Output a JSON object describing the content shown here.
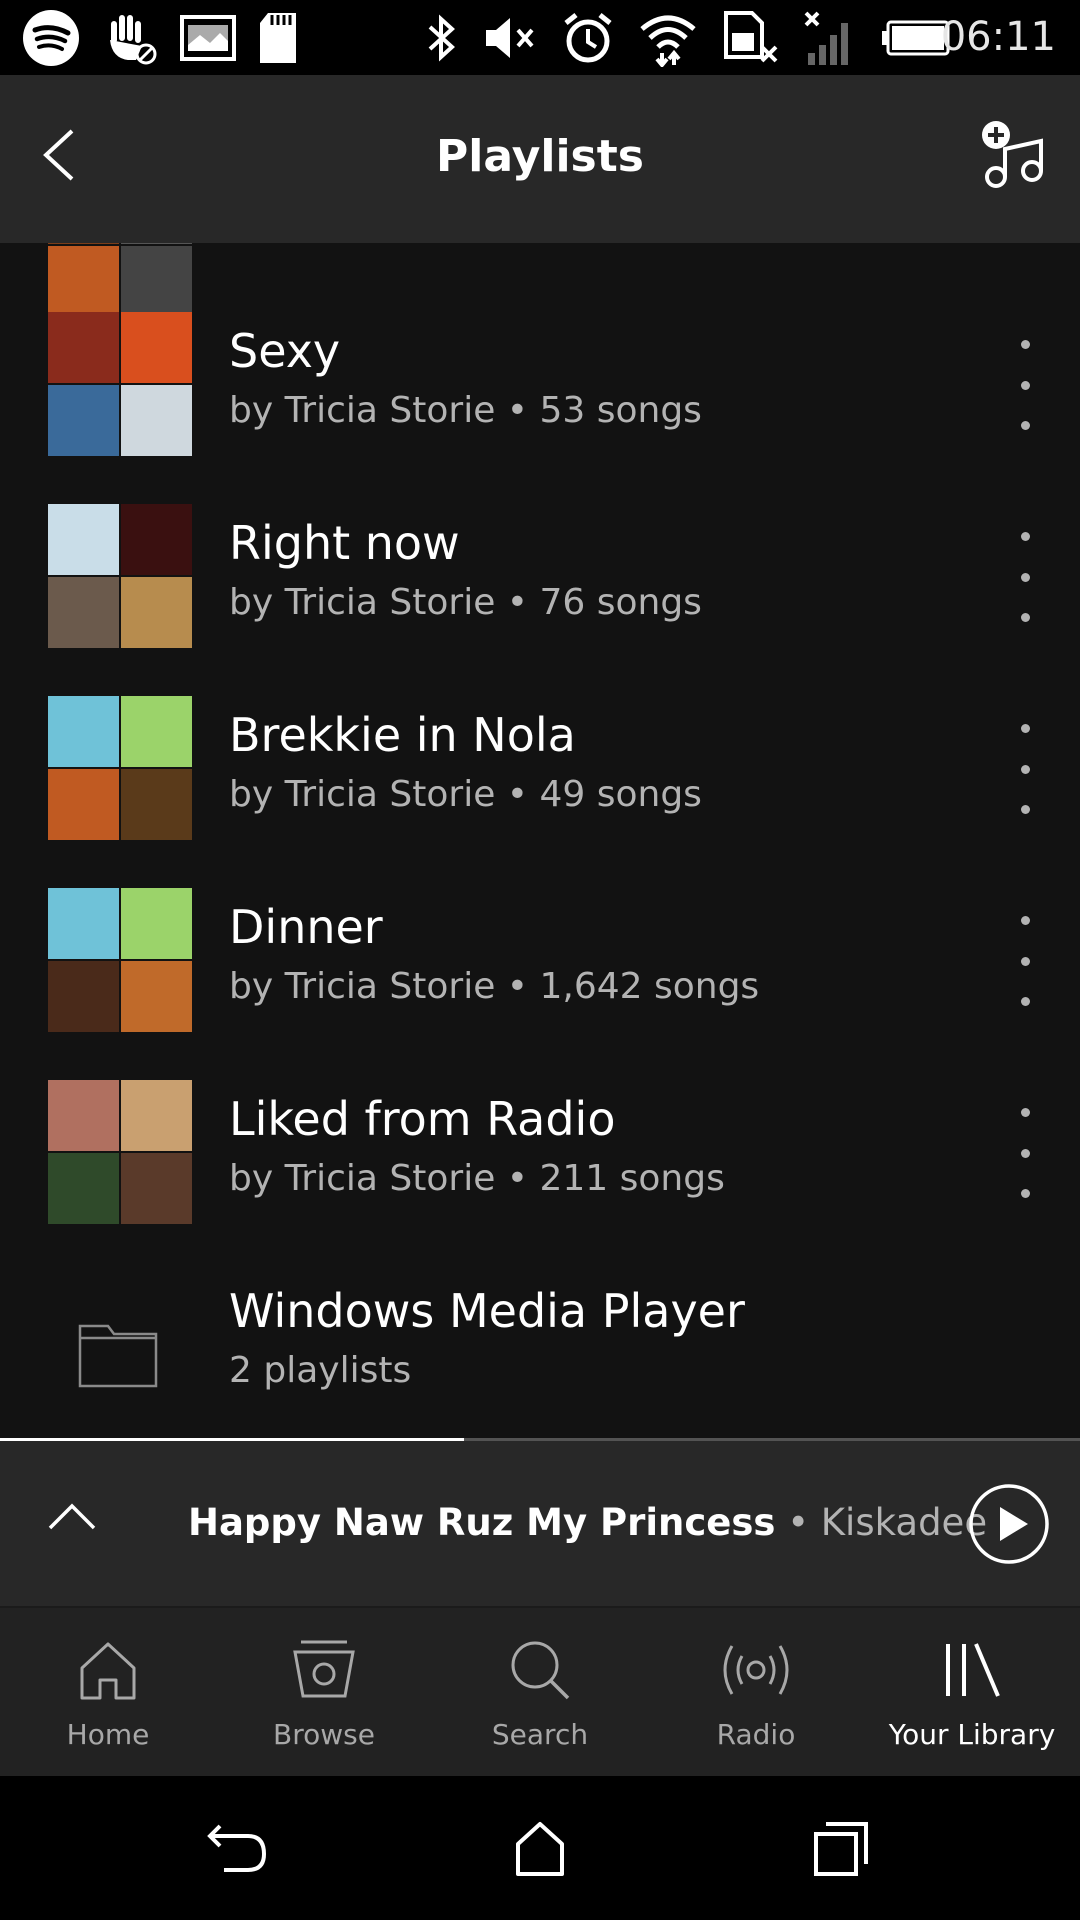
{
  "status_bar": {
    "time": "06:11",
    "left_icons": [
      "spotify-icon",
      "do-not-disturb-hand-icon",
      "image-icon",
      "sd-card-icon"
    ],
    "right_icons": [
      "bluetooth-icon",
      "muted-volume-icon",
      "alarm-icon",
      "wifi-icon",
      "no-sim-icon",
      "no-signal-icon",
      "battery-icon"
    ]
  },
  "header": {
    "title": "Playlists",
    "back_icon": "chevron-left-icon",
    "action_icon": "add-playlist-icon"
  },
  "playlists": [
    {
      "title": "Sexy",
      "subtitle": "by Tricia Storie • 53 songs",
      "cover_colors": [
        "#8a2b1c",
        "#d94f1e",
        "#3a6a9a",
        "#cfd8de"
      ]
    },
    {
      "title": "Right now",
      "subtitle": "by Tricia Storie • 76 songs",
      "cover_colors": [
        "#c9dde8",
        "#3a1010",
        "#6b5a4c",
        "#b78c4e"
      ]
    },
    {
      "title": "Brekkie in Nola",
      "subtitle": "by Tricia Storie • 49 songs",
      "cover_colors": [
        "#6fc2d8",
        "#9bd36a",
        "#c05a22",
        "#5a3a1a"
      ]
    },
    {
      "title": "Dinner",
      "subtitle": "by Tricia Storie • 1,642 songs",
      "cover_colors": [
        "#6fc2d8",
        "#9bd36a",
        "#4a2a1a",
        "#c06a2a"
      ]
    },
    {
      "title": "Liked from Radio",
      "subtitle": "by Tricia Storie • 211 songs",
      "cover_colors": [
        "#b07060",
        "#c9a070",
        "#2f4a2a",
        "#5a3a2a"
      ]
    }
  ],
  "folder": {
    "title": "Windows Media Player",
    "subtitle": "2 playlists",
    "icon": "folder-icon"
  },
  "now_playing": {
    "song": "Happy Naw Ruz My Princess",
    "separator": " • ",
    "artist": "Kiskadee",
    "progress": 0.43,
    "expand_icon": "chevron-up-icon",
    "play_icon": "play-icon"
  },
  "tabs": [
    {
      "label": "Home",
      "icon": "home-icon",
      "active": false
    },
    {
      "label": "Browse",
      "icon": "browse-icon",
      "active": false
    },
    {
      "label": "Search",
      "icon": "search-icon",
      "active": false
    },
    {
      "label": "Radio",
      "icon": "radio-icon",
      "active": false
    },
    {
      "label": "Your Library",
      "icon": "library-icon",
      "active": true
    }
  ],
  "nav_bar": [
    "back-icon",
    "home-icon",
    "recents-icon"
  ]
}
